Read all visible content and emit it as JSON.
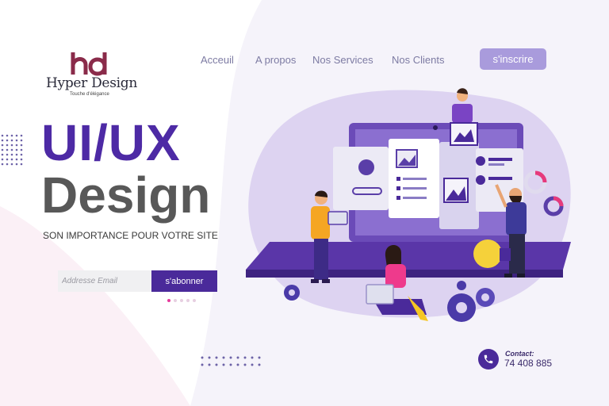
{
  "logo": {
    "name": "Hyper Design",
    "tagline": "Touche d'élégance"
  },
  "nav": {
    "items": [
      "Acceuil",
      "A propos",
      "Nos Services",
      "Nos Clients"
    ],
    "signup_label": "s'inscrire"
  },
  "hero": {
    "title_line1": "UI/UX",
    "title_line2": "Design",
    "subtitle": "SON IMPORTANCE POUR VOTRE SITE"
  },
  "newsletter": {
    "email_placeholder": "Addresse Email",
    "subscribe_label": "s'abonner",
    "slides_total": 5,
    "slide_active": 1
  },
  "contact": {
    "label": "Contact:",
    "phone": "74 408 885"
  },
  "colors": {
    "primary": "#4d2aa5",
    "accent_light": "#a99bdc",
    "text_gray": "#585858",
    "pink": "#e63a9c"
  }
}
